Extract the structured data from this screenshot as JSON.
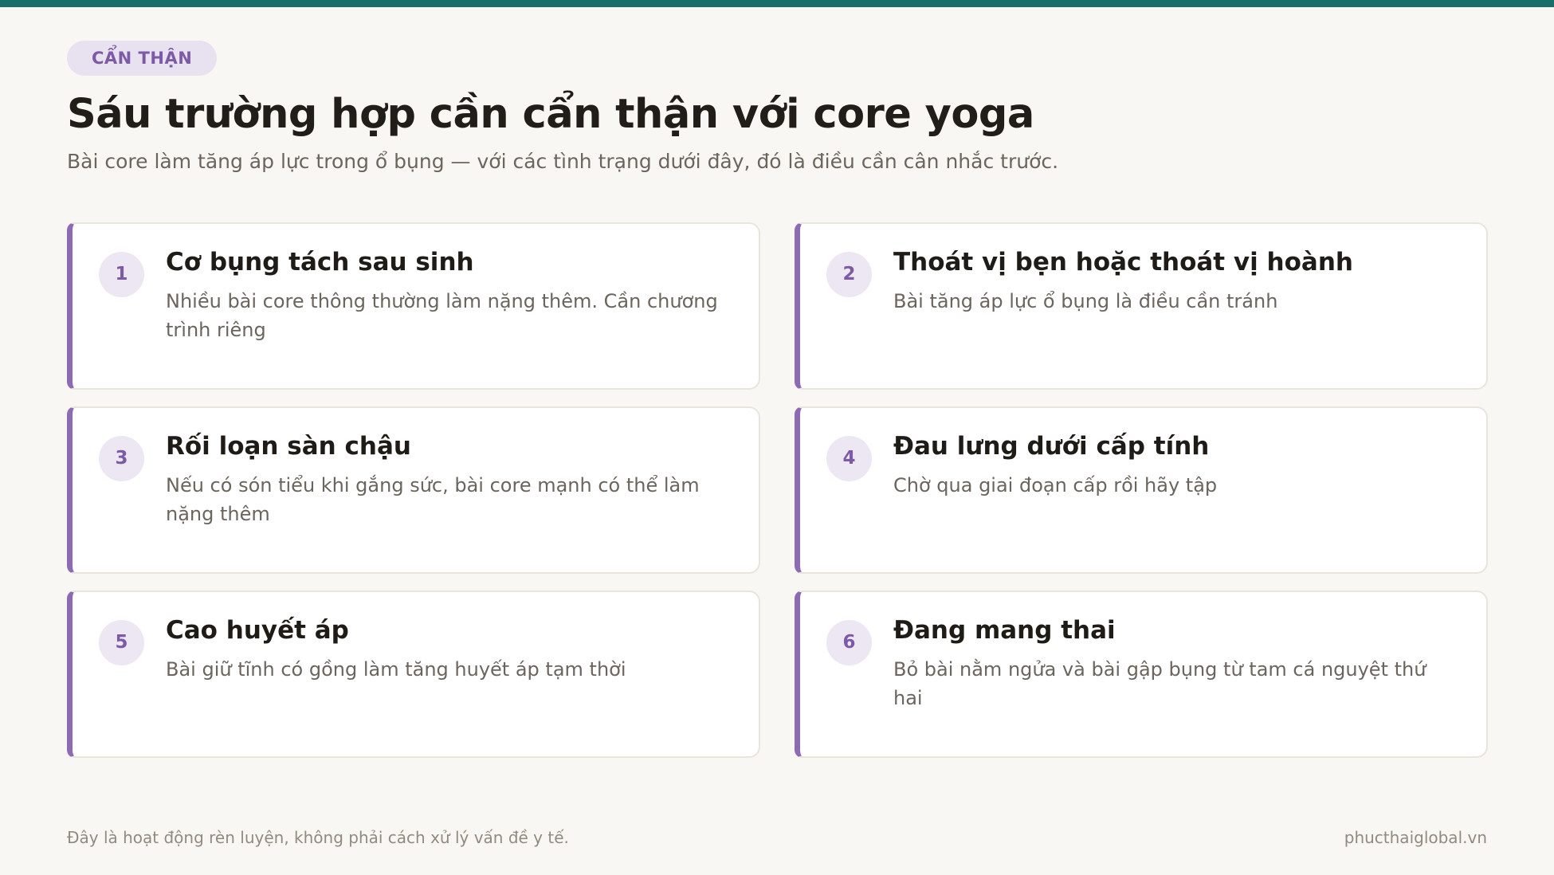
{
  "colors": {
    "top_bar": "#167068",
    "accent": "#8c6bb4",
    "badge_text": "#7d5aa5",
    "badge_bg": "#e8e1ef",
    "background": "#f9f7f3"
  },
  "header": {
    "badge": "CẨN THẬN",
    "title": "Sáu trường hợp cần cẩn thận với core yoga",
    "subtitle": "Bài core làm tăng áp lực trong ổ bụng — với các tình trạng dưới đây, đó là điều cần cân nhắc trước."
  },
  "cards": [
    {
      "number": "1",
      "title": "Cơ bụng tách sau sinh",
      "description": "Nhiều bài core thông thường làm nặng thêm. Cần chương trình riêng"
    },
    {
      "number": "2",
      "title": "Thoát vị bẹn hoặc thoát vị hoành",
      "description": "Bài tăng áp lực ổ bụng là điều cần tránh"
    },
    {
      "number": "3",
      "title": "Rối loạn sàn chậu",
      "description": "Nếu có són tiểu khi gắng sức, bài core mạnh có thể làm nặng thêm"
    },
    {
      "number": "4",
      "title": "Đau lưng dưới cấp tính",
      "description": "Chờ qua giai đoạn cấp rồi hãy tập"
    },
    {
      "number": "5",
      "title": "Cao huyết áp",
      "description": "Bài giữ tĩnh có gồng làm tăng huyết áp tạm thời"
    },
    {
      "number": "6",
      "title": "Đang mang thai",
      "description": "Bỏ bài nằm ngửa và bài gập bụng từ tam cá nguyệt thứ hai"
    }
  ],
  "footer": {
    "note": "Đây là hoạt động rèn luyện, không phải cách xử lý vấn đề y tế.",
    "site": "phucthaiglobal.vn"
  }
}
